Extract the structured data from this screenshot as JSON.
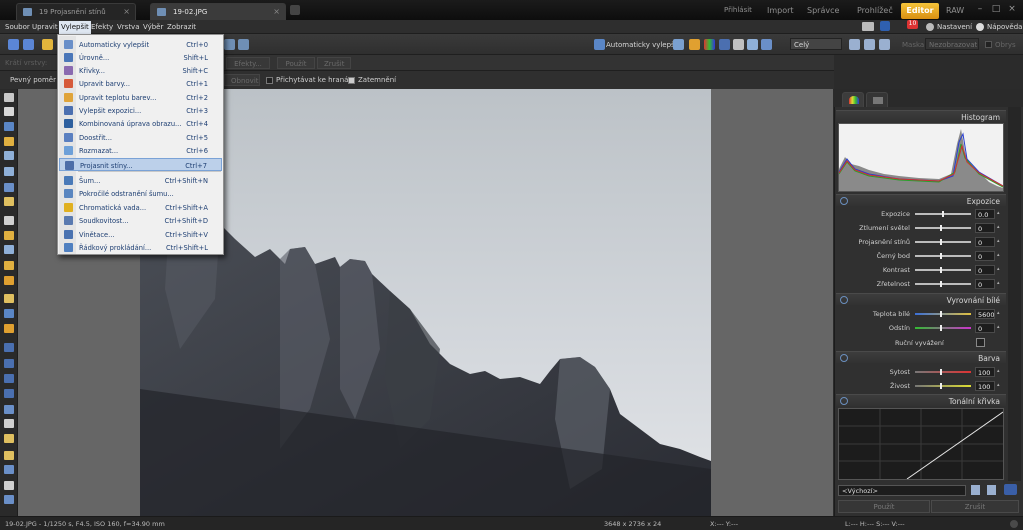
{
  "window_tabs": [
    {
      "label": "19 Projasnění stínů"
    },
    {
      "label": "19-02.JPG"
    }
  ],
  "modes": {
    "login": "Přihlásit",
    "import": "Import",
    "manager": "Správce",
    "viewer": "Prohlížeč",
    "editor": "Editor",
    "raw": "RAW"
  },
  "notifications_count": "10",
  "topright": {
    "settings": "Nastavení",
    "help": "Nápověda"
  },
  "menubar": [
    "Soubor",
    "Upravit",
    "Vylepšit",
    "Efekty",
    "Vrstva",
    "Výběr",
    "Zobrazit"
  ],
  "toolbar": {
    "auto_enhance": "Automaticky vylepšit",
    "zoom_value": "Celý",
    "mask_label": "Maska:",
    "mask_value": "Nezobrazovat",
    "overlay_label": "Obrys"
  },
  "options": {
    "thickness_label": "Krátí vrstvy:",
    "effects_btn": "Efekty...",
    "apply_btn": "Použít",
    "cancel_btn": "Zrušit",
    "reset_btn": "Obnovit",
    "snap_label": "Přichytávat ke hranám",
    "darken_label": "Zatemnění",
    "ratio_label": "Pevný poměr"
  },
  "enhance_menu": [
    {
      "label": "Automaticky vylepšit",
      "shortcut": "Ctrl+0",
      "icon": "auto-enhance-icon",
      "color": "#6a8fc8"
    },
    {
      "label": "Úrovně...",
      "shortcut": "Shift+L",
      "icon": "levels-icon",
      "color": "#4a76b8"
    },
    {
      "label": "Křivky...",
      "shortcut": "Shift+C",
      "icon": "curves-icon",
      "color": "#8a6ab0"
    },
    {
      "label": "Upravit barvy...",
      "shortcut": "Ctrl+1",
      "icon": "colors-icon",
      "color": "#d65a3a"
    },
    {
      "label": "Upravit teplotu barev...",
      "shortcut": "Ctrl+2",
      "icon": "temperature-icon",
      "color": "#e0a43a"
    },
    {
      "label": "Vylepšit expozici...",
      "shortcut": "Ctrl+3",
      "icon": "exposure-icon",
      "color": "#4b6fb0"
    },
    {
      "label": "Kombinovaná úprava obrazu...",
      "shortcut": "Ctrl+4",
      "icon": "combined-icon",
      "color": "#2d5f9e"
    },
    {
      "label": "Doostřit...",
      "shortcut": "Ctrl+5",
      "icon": "sharpen-icon",
      "color": "#5a7fc0"
    },
    {
      "label": "Rozmazat...",
      "shortcut": "Ctrl+6",
      "icon": "blur-icon",
      "color": "#6ea0d8"
    },
    {
      "label": "Projasnit stíny...",
      "shortcut": "Ctrl+7",
      "icon": "shadows-icon",
      "color": "#4d6ea8"
    },
    {
      "label": "Šum...",
      "shortcut": "Ctrl+Shift+N",
      "icon": "noise-icon",
      "color": "#4a7ab8"
    },
    {
      "label": "Pokročilé odstranění šumu...",
      "shortcut": "",
      "icon": "advanced-noise-icon",
      "color": "#5a86c0"
    },
    {
      "label": "Chromatická vada...",
      "shortcut": "Ctrl+Shift+A",
      "icon": "chromatic-icon",
      "color": "#e0b020"
    },
    {
      "label": "Soudkovitost...",
      "shortcut": "Ctrl+Shift+D",
      "icon": "barrel-icon",
      "color": "#5a7ab0"
    },
    {
      "label": "Vinětace...",
      "shortcut": "Ctrl+Shift+V",
      "icon": "vignette-icon",
      "color": "#4a72b0"
    },
    {
      "label": "Řádkový prokládání...",
      "shortcut": "Ctrl+Shift+L",
      "icon": "interlace-icon",
      "color": "#5080c0"
    }
  ],
  "panel": {
    "histogram_title": "Histogram",
    "exposure_title": "Expozice",
    "exposure_rows": [
      {
        "label": "Expozice",
        "value": "0.0"
      },
      {
        "label": "Ztlumení světel",
        "value": "0"
      },
      {
        "label": "Projasnění stínů",
        "value": "0"
      },
      {
        "label": "Černý bod",
        "value": "0"
      },
      {
        "label": "Kontrast",
        "value": "0"
      },
      {
        "label": "Zřetelnost",
        "value": "0"
      }
    ],
    "wb_title": "Vyrovnání bílé",
    "wb_rows": [
      {
        "label": "Teplota bílé",
        "value": "5600"
      },
      {
        "label": "Odstín",
        "value": "0"
      }
    ],
    "manual_wb": "Ruční vyvážení",
    "color_title": "Barva",
    "color_rows": [
      {
        "label": "Sytost",
        "value": "100"
      },
      {
        "label": "Živost",
        "value": "100"
      }
    ],
    "curve_title": "Tonální křivka",
    "preset_value": "<Výchozí>",
    "apply_btn": "Použít",
    "cancel_btn": "Zrušit"
  },
  "status": {
    "file_info": "19-02.JPG - 1/1250 s, F4.5, ISO 160, f=34.90 mm",
    "dimensions": "3648 x 2736 x 24",
    "coords": "X:--- Y:---",
    "rgb": "L:--- H:--- S:--- V:---"
  }
}
